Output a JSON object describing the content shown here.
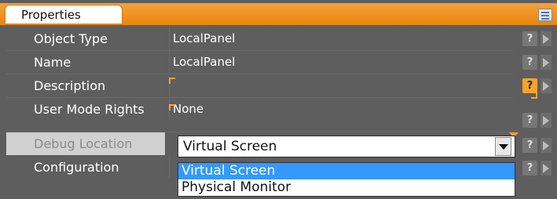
{
  "panel": {
    "tab_title": "Properties"
  },
  "properties": [
    {
      "label": "Object Type",
      "value": "LocalPanel"
    },
    {
      "label": "Name",
      "value": "LocalPanel"
    },
    {
      "label": "Description",
      "value": ""
    },
    {
      "label": "User Mode Rights",
      "value": "None"
    },
    {
      "label": "Debug Location",
      "value": "Virtual Screen"
    },
    {
      "label": "Configuration",
      "value": ""
    }
  ],
  "help_icon_glyph": "?",
  "debug_location_dropdown": {
    "selected": "Virtual Screen",
    "options": [
      "Virtual Screen",
      "Physical Monitor"
    ]
  },
  "colors": {
    "accent": "#f4a52b",
    "selection": "#3399ff",
    "panel_bg": "#5e5e5e"
  }
}
